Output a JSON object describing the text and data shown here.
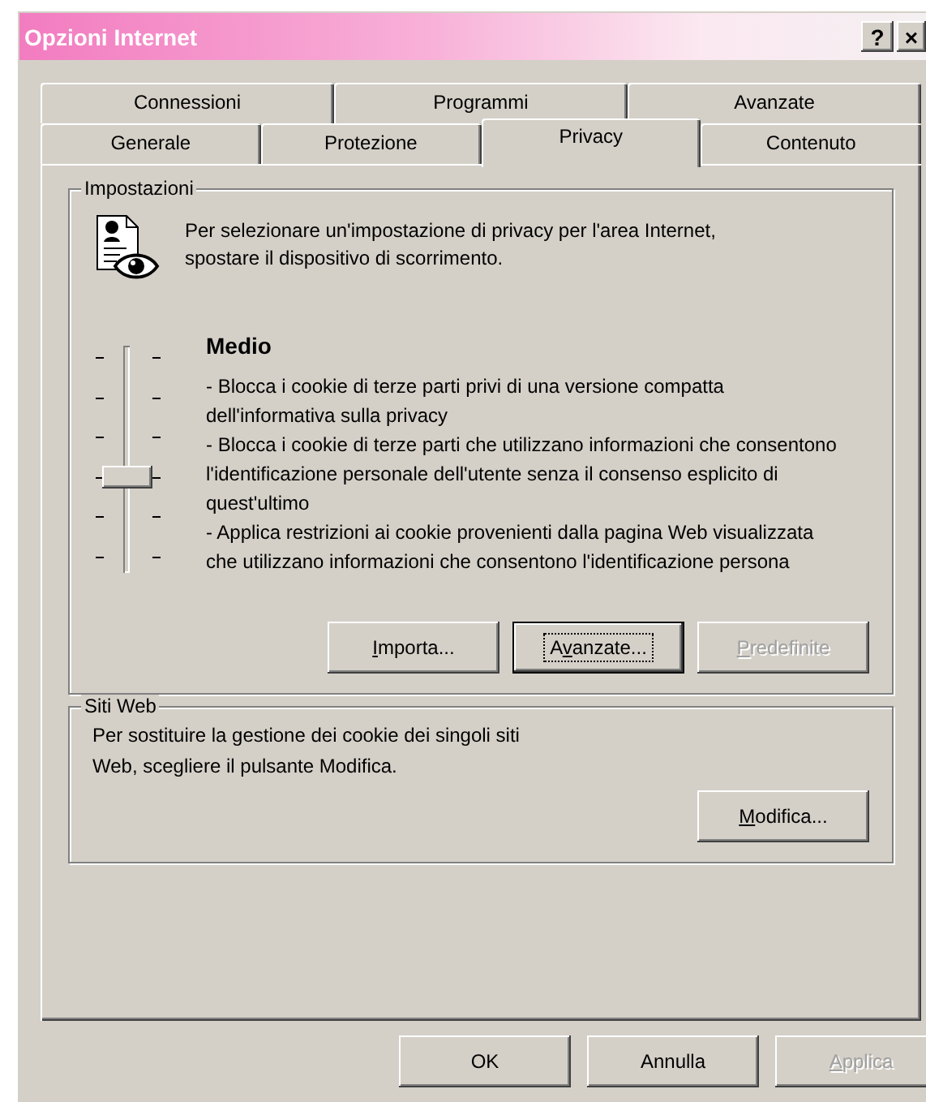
{
  "window": {
    "title": "Opzioni Internet",
    "help_button": "?",
    "close_button": "×"
  },
  "tab_rows": [
    [
      {
        "label": "Connessioni",
        "selected": false
      },
      {
        "label": "Programmi",
        "selected": false
      },
      {
        "label": "Avanzate",
        "selected": false
      }
    ],
    [
      {
        "label": "Generale",
        "selected": false
      },
      {
        "label": "Protezione",
        "selected": false
      },
      {
        "label": "Privacy",
        "selected": true
      },
      {
        "label": "Contenuto",
        "selected": false
      }
    ]
  ],
  "settings": {
    "group_title": "Impostazioni",
    "intro": "Per selezionare un'impostazione di privacy per l'area Internet, spostare il dispositivo di scorrimento.",
    "slider": {
      "level": 0.4
    },
    "level_name": "Medio",
    "description": [
      "- Blocca i cookie di terze parti privi di una versione compatta dell'informativa sulla privacy",
      "- Blocca i cookie di terze parti che utilizzano informazioni che consentono l'identificazione personale dell'utente senza il consenso esplicito di quest'ultimo",
      "- Applica restrizioni ai cookie provenienti dalla pagina Web visualizzata che utilizzano informazioni che consentono l'identificazione persona"
    ],
    "buttons": [
      {
        "label": {
          "key": "I",
          "after": "mporta..."
        },
        "disabled": false,
        "focused": false
      },
      {
        "label": {
          "before": "A",
          "key": "v",
          "after": "anzate..."
        },
        "disabled": false,
        "focused": true
      },
      {
        "label": {
          "key": "P",
          "after": "redefinite"
        },
        "disabled": true,
        "focused": false
      }
    ]
  },
  "websites": {
    "group_title": "Siti Web",
    "text": "Per sostituire la gestione dei cookie dei singoli siti Web, scegliere il pulsante Modifica.",
    "button": {
      "label": {
        "key": "M",
        "after": "odifica..."
      },
      "disabled": false,
      "focused": false
    }
  },
  "footer_buttons": [
    {
      "label": {
        "before": "OK"
      },
      "disabled": false,
      "focused": false
    },
    {
      "label": {
        "before": "Annulla"
      },
      "disabled": false,
      "focused": false
    },
    {
      "label": {
        "key": "A",
        "after": "pplica"
      },
      "disabled": true,
      "focused": false
    }
  ]
}
